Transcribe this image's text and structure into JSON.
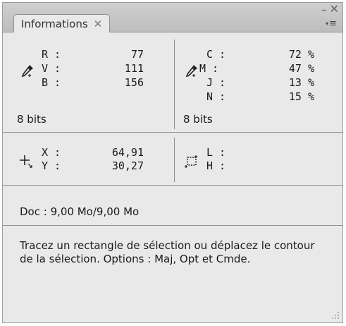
{
  "panel": {
    "tab_label": "Informations",
    "tab_close": "✕",
    "window_minimize": "–",
    "window_close": "✕",
    "menu_symbol": "≡"
  },
  "rgb": {
    "labels": [
      "R :",
      "V :",
      "B :"
    ],
    "values": [
      "77",
      "111",
      "156"
    ],
    "bits": "8 bits",
    "icon": "eyedropper-icon"
  },
  "cmyk": {
    "labels": [
      "C :",
      "M :",
      "J :",
      "N :"
    ],
    "values": [
      "72 %",
      "47 %",
      "13 %",
      "15 %"
    ],
    "bits": "8 bits",
    "icon": "eyedropper-icon"
  },
  "position": {
    "labels": [
      "X :",
      "Y :"
    ],
    "values": [
      "64,91",
      "30,27"
    ],
    "icon": "crosshair-icon"
  },
  "size": {
    "labels": [
      "L :",
      "H :"
    ],
    "values": [
      "",
      ""
    ],
    "icon": "selection-size-icon"
  },
  "doc_info": "Doc : 9,00 Mo/9,00 Mo",
  "hint_text": "Tracez un rectangle de sélection ou déplacez le contour de la sélection. Options : Maj, Opt et Cmde."
}
